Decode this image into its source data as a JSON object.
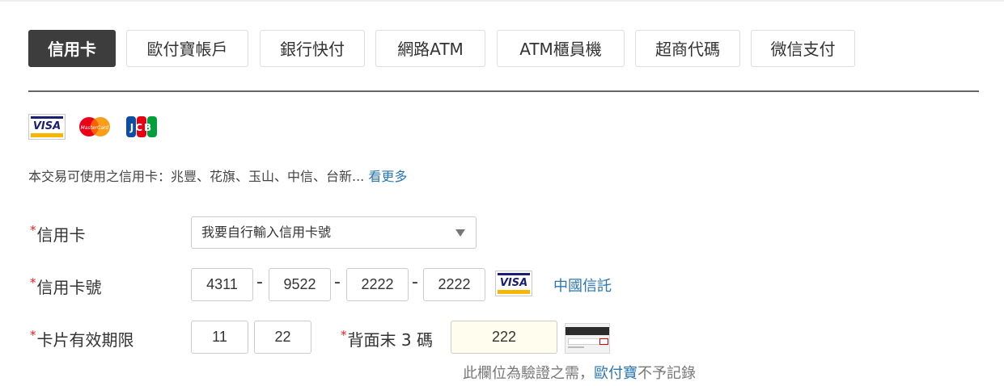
{
  "tabs": [
    {
      "label": "信用卡",
      "active": true
    },
    {
      "label": "歐付寶帳戶",
      "active": false
    },
    {
      "label": "銀行快付",
      "active": false
    },
    {
      "label": "網路ATM",
      "active": false
    },
    {
      "label": "ATM櫃員機",
      "active": false
    },
    {
      "label": "超商代碼",
      "active": false
    },
    {
      "label": "微信支付",
      "active": false
    }
  ],
  "card_logos": [
    "visa-logo",
    "mastercard-logo",
    "jcb-logo"
  ],
  "logos": {
    "visa_text": "VISA",
    "mastercard_text": "MasterCard",
    "jcb_text": "JCB"
  },
  "notice": {
    "text": "本交易可使用之信用卡：兆豐、花旗、玉山、中信、台新...",
    "more_link": "看更多"
  },
  "form": {
    "required_mark": "*",
    "card_select": {
      "label": "信用卡",
      "value": "我要自行輸入信用卡號"
    },
    "card_number": {
      "label": "信用卡號",
      "parts": [
        "4311",
        "9522",
        "2222",
        "2222"
      ],
      "separator": "-",
      "card_type": "VISA",
      "bank_name": "中國信託"
    },
    "expiry": {
      "label": "卡片有效期限",
      "month": "11",
      "year": "22"
    },
    "cvv": {
      "label": "背面末 3 碼",
      "value": "222",
      "hint_prefix": "此欄位為驗證之需，",
      "hint_brand": "歐付寶",
      "hint_suffix": "不予記錄"
    }
  },
  "colors": {
    "active_tab_bg": "#3d3d3d",
    "link": "#2a76b2",
    "required": "#e02020",
    "visa_blue": "#1a1f71",
    "visa_gold": "#f7b600",
    "cvv_bg": "#fffdee"
  }
}
